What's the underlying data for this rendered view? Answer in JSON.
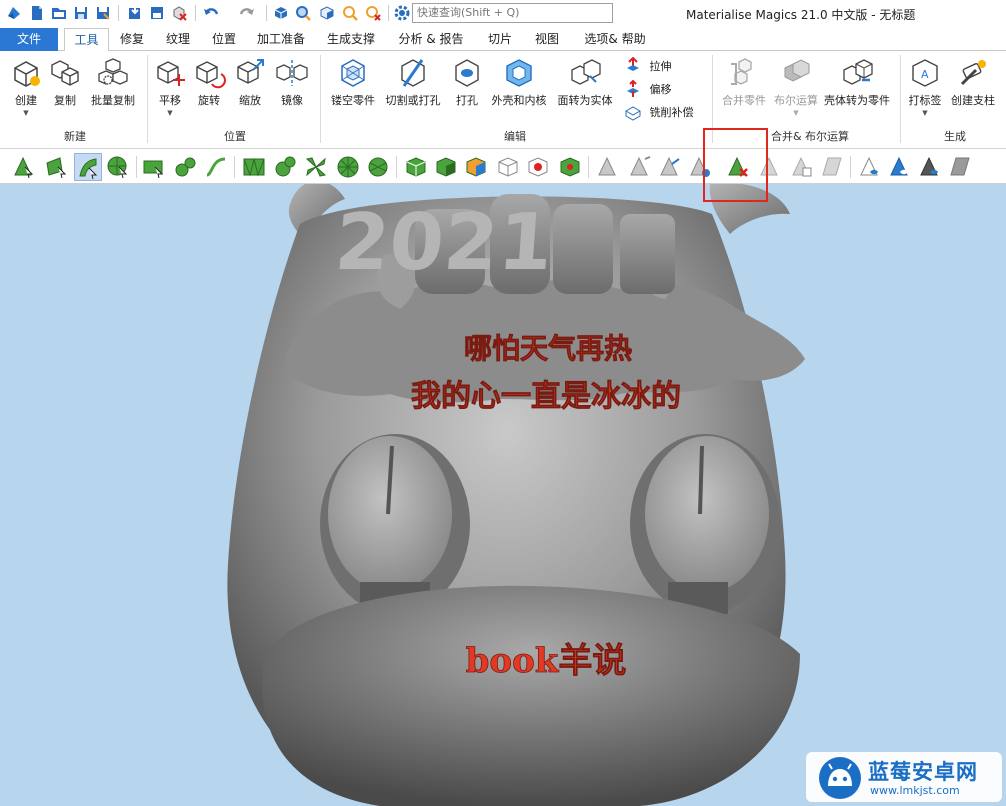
{
  "window": {
    "title": "Materialise Magics 21.0 中文版 - 无标题",
    "search_placeholder": "快速查询(Shift + Q)"
  },
  "tabs": [
    {
      "label": "文件"
    },
    {
      "label": "工具"
    },
    {
      "label": "修复"
    },
    {
      "label": "纹理"
    },
    {
      "label": "位置"
    },
    {
      "label": "加工准备"
    },
    {
      "label": "生成支撑"
    },
    {
      "label": "分析 & 报告"
    },
    {
      "label": "切片"
    },
    {
      "label": "视图"
    },
    {
      "label": "选项& 帮助"
    }
  ],
  "active_tab": "工具",
  "ribbon": {
    "new_group": {
      "label": "新建",
      "buttons": [
        {
          "label": "创建"
        },
        {
          "label": "复制"
        },
        {
          "label": "批量复制"
        }
      ]
    },
    "position_group": {
      "label": "位置",
      "buttons": [
        {
          "label": "平移"
        },
        {
          "label": "旋转"
        },
        {
          "label": "缩放"
        },
        {
          "label": "镜像"
        }
      ]
    },
    "edit_group": {
      "label": "编辑",
      "buttons": [
        {
          "label": "镂空零件"
        },
        {
          "label": "切割或打孔"
        },
        {
          "label": "打孔"
        },
        {
          "label": "外壳和内核"
        },
        {
          "label": "面转为实体"
        }
      ],
      "small_buttons": [
        {
          "label": "拉伸"
        },
        {
          "label": "偏移"
        },
        {
          "label": "铣削补偿"
        }
      ]
    },
    "merge_group": {
      "label": "合并& 布尔运算",
      "buttons": [
        {
          "label": "合并零件"
        },
        {
          "label": "布尔运算"
        },
        {
          "label": "壳体转为零件"
        }
      ]
    },
    "generate_group": {
      "label": "生成",
      "buttons": [
        {
          "label": "打标签"
        },
        {
          "label": "创建支柱"
        }
      ]
    }
  },
  "model": {
    "year_text": "2021",
    "line1": "哪怕天气再热",
    "line2": "我的心一直是冰冰的",
    "line3": "book羊说"
  },
  "watermark": {
    "title": "蓝莓安卓网",
    "url": "www.lmkjst.com"
  },
  "colors": {
    "accent": "#2b78d4",
    "highlight_box": "#e0261f",
    "model_text": "#e03a25",
    "viewport_bg": "#b7d6ee",
    "toolbar_green": "#4aa33d"
  }
}
